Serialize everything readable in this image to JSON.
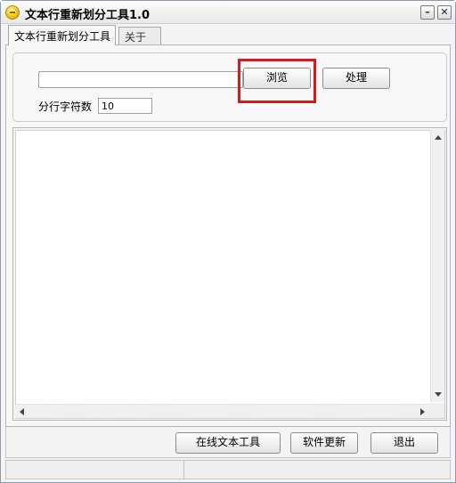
{
  "window": {
    "title": "文本行重新划分工具1.0",
    "minimize_glyph": "–",
    "close_glyph": "✕",
    "app_icon": "app-coin-icon"
  },
  "tabs": [
    {
      "label": "文本行重新划分工具",
      "active": true
    },
    {
      "label": "关于",
      "active": false
    }
  ],
  "form": {
    "path_value": "",
    "browse_label": "浏览",
    "process_label": "处理",
    "chars_label": "分行字符数",
    "chars_value": "10",
    "highlight_color": "#d21c1c"
  },
  "output": {
    "text": ""
  },
  "footer": {
    "online_label": "在线文本工具",
    "update_label": "软件更新",
    "exit_label": "退出"
  },
  "status": {
    "segment1": "",
    "segment2": ""
  }
}
